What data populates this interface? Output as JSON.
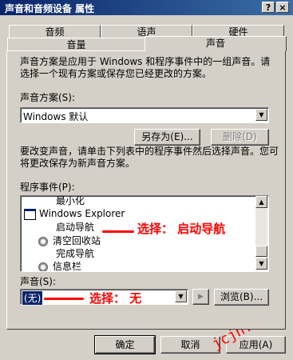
{
  "window": {
    "title": "声音和音频设备 属性",
    "help_btn": "?",
    "close_btn": "×"
  },
  "tabs": {
    "back_row": [
      "音频",
      "语声",
      "硬件"
    ],
    "front_row": [
      "音量",
      "声音"
    ],
    "active": "声音"
  },
  "scheme": {
    "description": "声音方案是应用于 Windows 和程序事件中的一组声音。请选择一个现有方案或保存您已经更改的方案。",
    "label": "声音方案(S):",
    "selected": "Windows 默认",
    "save_as_btn": "另存为(E)...",
    "delete_btn": "删除(D)"
  },
  "events": {
    "description": "要改变声音，请单击下列表中的程序事件然后选择声音。您可将更改保存为新声音方案。",
    "label": "程序事件(P):",
    "items": [
      {
        "label": "最小化",
        "icon": "none"
      },
      {
        "label": "Windows Explorer",
        "icon": "window-icon"
      },
      {
        "label": "启动导航",
        "icon": "none"
      },
      {
        "label": "清空回收站",
        "icon": "speaker-icon"
      },
      {
        "label": "完成导航",
        "icon": "none"
      },
      {
        "label": "信息栏",
        "icon": "speaker-icon"
      }
    ],
    "annotation": "选择： 启动导航"
  },
  "sound": {
    "label": "声音(S):",
    "selected": "(无)",
    "annotation": "选择： 无",
    "play_icon": "play-icon",
    "browse_btn": "浏览(B)..."
  },
  "footer": {
    "ok": "确定",
    "cancel": "取消",
    "apply": "应用(A)"
  },
  "watermark": "jcjh.com",
  "colors": {
    "titlebar": "#0a246a",
    "annotation": "#ff0000",
    "face": "#d4d0c8"
  }
}
